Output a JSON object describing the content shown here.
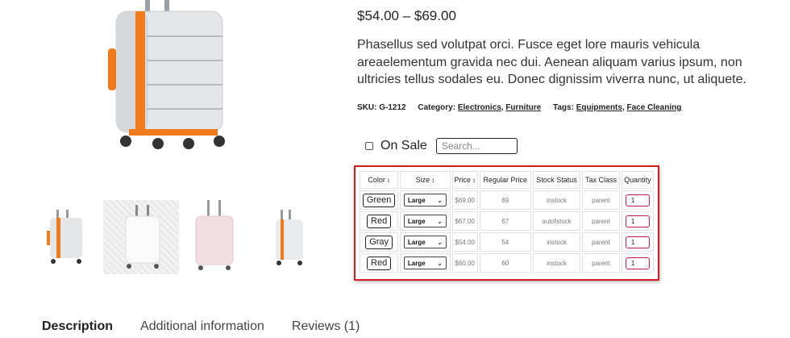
{
  "product": {
    "price_range": "$54.00 – $69.00",
    "description": "Phasellus sed volutpat orci. Fusce eget lore mauris vehicula areaelementum gravida nec dui. Aenean aliquam varius ipsum, non ultricies tellus sodales eu. Donec dignissim viverra nunc, ut aliquete.",
    "meta": {
      "sku_label": "SKU:",
      "sku": "G-1212",
      "category_label": "Category:",
      "categories": [
        "Electronics",
        "Furniture"
      ],
      "tags_label": "Tags:",
      "tags": [
        "Equipments",
        "Face Cleaning"
      ]
    },
    "thumbnails": [
      "orange-suitcase",
      "white-suitcase",
      "pink-suitcase",
      "orange-suitcase-small"
    ]
  },
  "filters": {
    "on_sale_label": "On Sale",
    "search_placeholder": "Search..."
  },
  "table": {
    "headers": [
      "Color",
      "Size",
      "Price",
      "Regular Price",
      "Stock Status",
      "Tax Class",
      "Quantity"
    ],
    "rows": [
      {
        "color": "Green",
        "size": "Large",
        "price": "$69.00",
        "regular_price": "69",
        "stock": "instock",
        "tax": "parent",
        "qty": "1"
      },
      {
        "color": "Red",
        "size": "Large",
        "price": "$67.00",
        "regular_price": "67",
        "stock": "outofstock",
        "tax": "parent",
        "qty": "1"
      },
      {
        "color": "Gray",
        "size": "Large",
        "price": "$54.00",
        "regular_price": "54",
        "stock": "instock",
        "tax": "parent",
        "qty": "1"
      },
      {
        "color": "Red",
        "size": "Large",
        "price": "$60.00",
        "regular_price": "60",
        "stock": "instock",
        "tax": "parent",
        "qty": "1"
      }
    ]
  },
  "tabs": [
    "Description",
    "Additional information",
    "Reviews (1)"
  ],
  "colors": {
    "highlight_border": "#d31a22",
    "suitcase_orange": "#f07b1c",
    "quantity_border": "#c2185b"
  }
}
